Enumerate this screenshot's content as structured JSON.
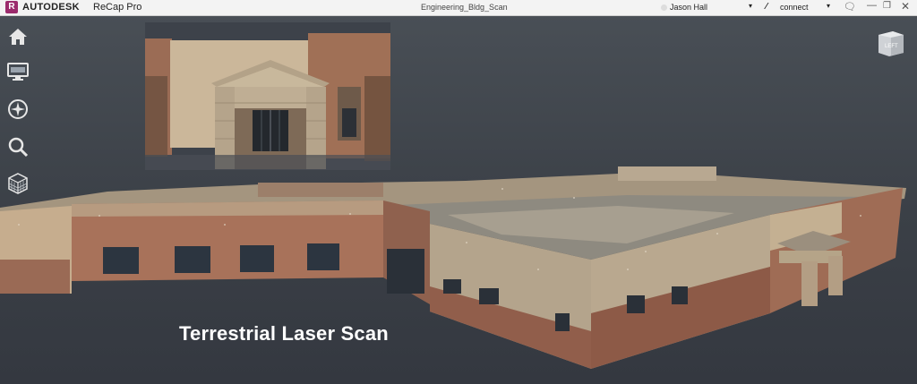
{
  "titlebar": {
    "logo_letter": "R",
    "brand": "AUTODESK",
    "product": "ReCap Pro",
    "document": "Engineering_Bldg_Scan",
    "user": "Jason Hall",
    "connect_label": "connect",
    "caret": "▾"
  },
  "toolbar": {
    "icons": [
      "home-icon",
      "display-icon",
      "compass-icon",
      "search-icon",
      "cube-icon"
    ]
  },
  "navcube": {
    "face_label": "LEFT"
  },
  "caption": "Terrestrial Laser Scan",
  "colors": {
    "background": "#3b4047",
    "titlebar": "#f3f3f3",
    "logo": "#9b2b6c",
    "brick": "#8c5a47",
    "stone": "#b8a48a"
  }
}
